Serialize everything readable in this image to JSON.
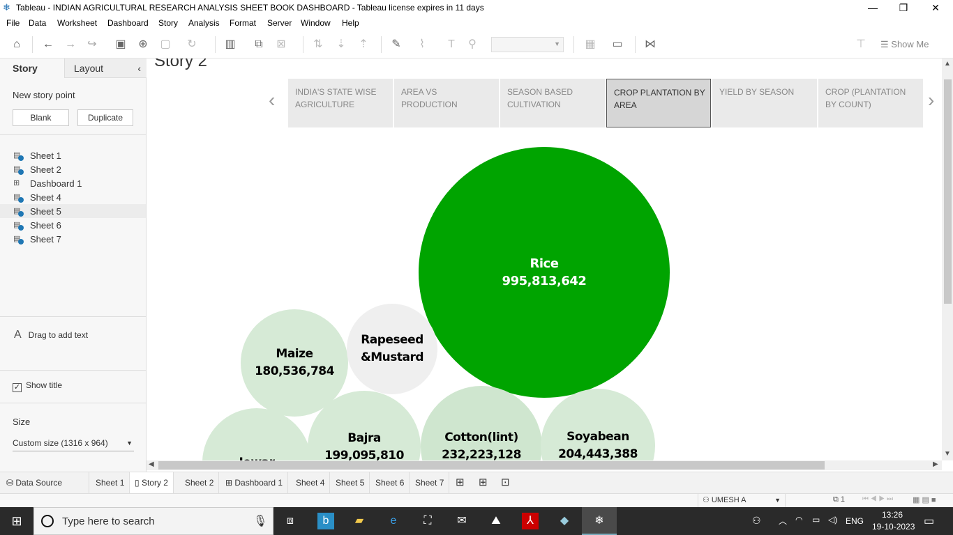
{
  "window": {
    "title": "Tableau - INDIAN AGRICULTURAL RESEARCH ANALYSIS SHEET BOOK DASHBOARD - Tableau license expires in 11 days",
    "minimize": "—",
    "restore": "❐",
    "close": "✕"
  },
  "menu": [
    "File",
    "Data",
    "Worksheet",
    "Dashboard",
    "Story",
    "Analysis",
    "Format",
    "Server",
    "Window",
    "Help"
  ],
  "toolbar": {
    "show_me": "Show Me"
  },
  "left_panel": {
    "tab_story": "Story",
    "tab_layout": "Layout",
    "collapse": "‹",
    "new_story_point": "New story point",
    "blank_button": "Blank",
    "duplicate_button": "Duplicate",
    "sheets": [
      {
        "label": "Sheet 1",
        "icon": "worksheet-icon"
      },
      {
        "label": "Sheet 2",
        "icon": "worksheet-icon"
      },
      {
        "label": "Dashboard 1",
        "icon": "dashboard-icon"
      },
      {
        "label": "Sheet 4",
        "icon": "worksheet-icon"
      },
      {
        "label": "Sheet 5",
        "icon": "worksheet-icon"
      },
      {
        "label": "Sheet 6",
        "icon": "worksheet-icon"
      },
      {
        "label": "Sheet 7",
        "icon": "worksheet-icon"
      }
    ],
    "drag_text_icon": "A",
    "drag_text": "Drag to add text",
    "show_title_checked": "✓",
    "show_title": "Show title",
    "size_header": "Size",
    "size_value": "Custom size (1316 x 964)"
  },
  "story": {
    "title": "Story 2",
    "prev_arrow": "‹",
    "next_arrow": "›",
    "points": [
      "INDIA'S STATE WISE AGRICULTURE",
      "AREA VS PRODUCTION",
      "SEASON BASED CULTIVATION",
      "CROP PLANTATION BY AREA",
      "YIELD BY SEASON",
      "CROP (PLANTATION BY COUNT)"
    ],
    "active_point": 3
  },
  "chart_data": {
    "type": "packed-bubble",
    "measure": "Area",
    "colors": {
      "max": "#00a400",
      "light": "#d6ead6",
      "neutral": "#efefef"
    },
    "bubbles": [
      {
        "name": "Rice",
        "value": 995813642,
        "label": "995,813,642"
      },
      {
        "name": "Maize",
        "value": 180536784,
        "label": "180,536,784"
      },
      {
        "name": "Rapeseed &Mustard",
        "value": null,
        "label": ""
      },
      {
        "name": "Jowar",
        "value": null,
        "label": ""
      },
      {
        "name": "Bajra",
        "value": 199095810,
        "label": "199,095,810"
      },
      {
        "name": "Cotton(lint)",
        "value": 232223128,
        "label": "232,223,128"
      },
      {
        "name": "Soyabean",
        "value": 204443388,
        "label": "204,443,388"
      }
    ]
  },
  "sheet_tabs": {
    "data_source": "Data Source",
    "tabs": [
      "Sheet 1",
      "Story 2",
      "Sheet 2",
      "Dashboard 1",
      "Sheet 4",
      "Sheet 5",
      "Sheet 6",
      "Sheet 7"
    ],
    "active": "Story 2"
  },
  "status": {
    "user": "UMESH A",
    "marks_count": "1"
  },
  "taskbar": {
    "search_placeholder": "Type here to search",
    "language": "ENG",
    "time": "13:26",
    "date": "19-10-2023"
  }
}
